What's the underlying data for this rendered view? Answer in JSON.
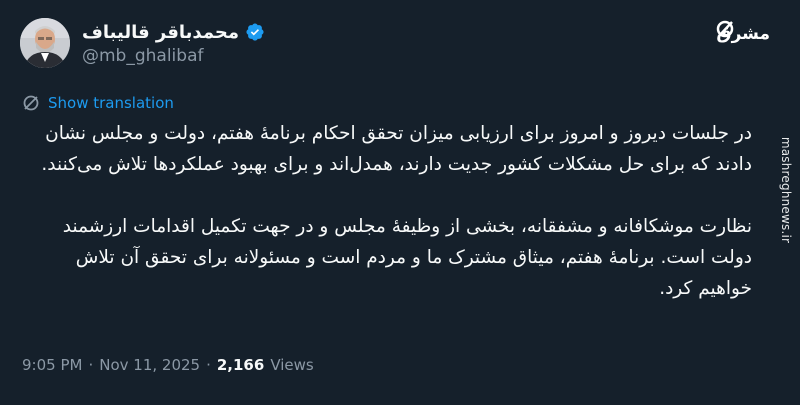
{
  "author": {
    "display_name": "محمدباقر قالیباف",
    "handle": "@mb_ghalibaf",
    "verified": true,
    "avatar_icon": "profile-photo"
  },
  "translation": {
    "label": "Show translation",
    "icon": "translate-icon"
  },
  "tweet": {
    "paragraphs": [
      "در جلسات دیروز و امروز برای ارزیابی میزان تحقق احکام برنامهٔ هفتم، دولت و مجلس نشان دادند که برای حل مشکلات کشور جدیت دارند، همدل‌اند و برای بهبود عملکردها تلاش می‌کنند.",
      "نظارت موشکافانه و مشفقانه، بخشی از وظیفهٔ مجلس و در جهت تکمیل اقدامات ارزشمند دولت است. برنامهٔ هفتم، میثاق مشترک ما و مردم است و مسئولانه برای تحقق آن تلاش خواهیم کرد."
    ]
  },
  "meta": {
    "time": "9:05 PM",
    "separator": "·",
    "date": "Nov 11, 2025",
    "views_count": "2,166",
    "views_label": "Views"
  },
  "watermark": {
    "text": "مشرق",
    "side_url": "mashreghnews.ir"
  },
  "colors": {
    "background": "#15202b",
    "text": "#f7f9f9",
    "secondary": "#8b98a5",
    "accent": "#1d9bf0"
  }
}
